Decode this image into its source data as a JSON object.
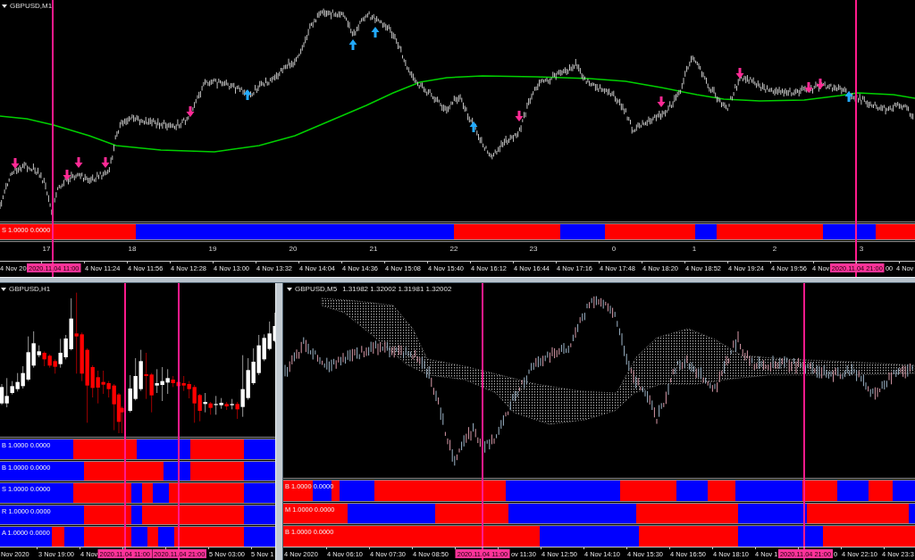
{
  "top_chart": {
    "title": "GBPUSD,M1",
    "indicator_strips": [
      "S 1.0000 0.0000"
    ],
    "hour_labels": [
      "17",
      "18",
      "19",
      "20",
      "21",
      "22",
      "23",
      "0",
      "1",
      "2",
      "3"
    ],
    "time_axis": [
      "4 Nov 20",
      "4 Nov 11:24",
      "4 Nov 11:56",
      "4 Nov 12:28",
      "4 Nov 13:00",
      "4 Nov 13:32",
      "4 Nov 14:04",
      "4 Nov 14:36",
      "4 Nov 15:08",
      "4 Nov 15:40",
      "4 Nov 16:12",
      "4 Nov 16:44",
      "4 Nov 17:16",
      "4 Nov 17:48",
      "4 Nov 18:20",
      "4 Nov 18:52",
      "4 Nov 19:24",
      "4 Nov 19:56",
      "4 Nov",
      "00",
      "4 Nov"
    ],
    "cursor_labels": [
      "2020.11.04 11:00",
      "2020.11.04 21:00"
    ]
  },
  "bottom_left_chart": {
    "title": "GBPUSD,H1",
    "indicator_strips": [
      "B 1.0000 0.0000",
      "B 1.0000 0.0000",
      "S 1.0000 0.0000",
      "R 1.0000 0.0000",
      "A 1.0000 0.0000"
    ],
    "time_axis": [
      "Nov 2020",
      "3 Nov 19:00",
      "4 Nov",
      "5 Nov 03:00",
      "5 Nov 1"
    ],
    "cursor_labels": [
      "2020.11.04 11:00",
      "2020.11.04 21:00"
    ]
  },
  "bottom_right_chart": {
    "title": "GBPUSD,M5",
    "quote": "1.31982 1.32002 1.31981 1.32002",
    "indicator_strips": [
      "B 1.0000 0.0000",
      "M 1.0000 0.0000",
      "B 1.0000 0.0000"
    ],
    "time_axis": [
      "4 Nov 2020",
      "4 Nov 06:10",
      "4 Nov 07:30",
      "4 Nov 08:50",
      "ov 11:30",
      "4 Nov 12:50",
      "4 Nov 14:10",
      "4 Nov 15:30",
      "4 Nov 16:50",
      "4 Nov 18:10",
      "4 Nov 1",
      "0",
      "4 Nov 22:10",
      "4 Nov 23:3"
    ],
    "cursor_labels": [
      "2020.11.04 11:00",
      "2020.11.04 21:00"
    ]
  }
}
